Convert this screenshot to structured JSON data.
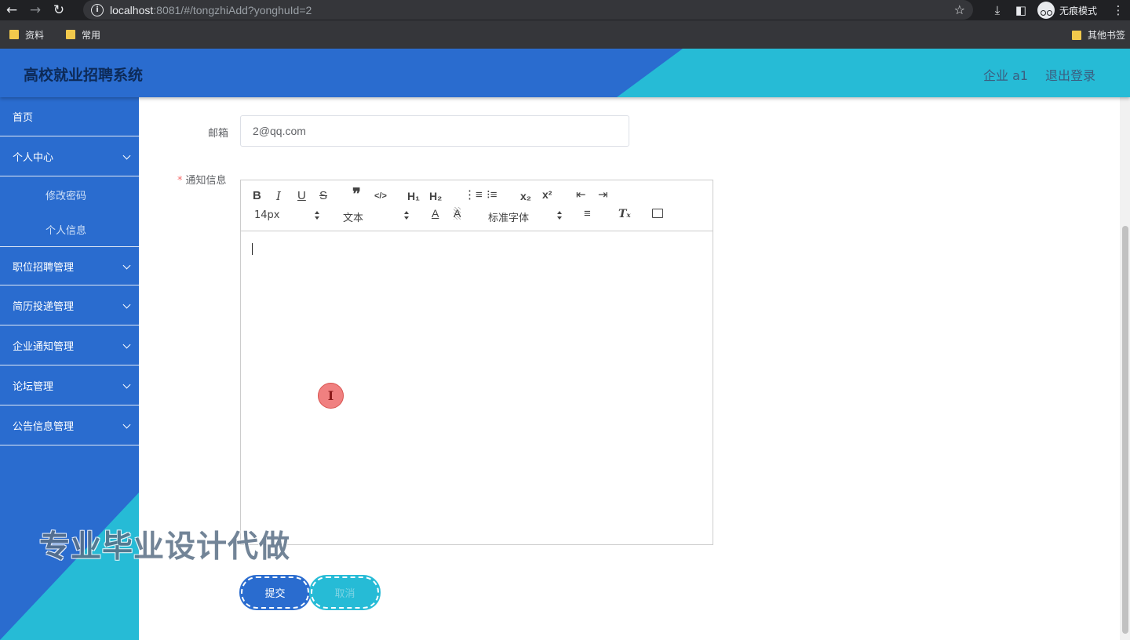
{
  "browser": {
    "url_host": "localhost",
    "url_path": ":8081/#/tongzhiAdd?yonghuId=2",
    "incognito_label": "无痕模式",
    "bookmarks": [
      "资料",
      "常用"
    ],
    "other_bookmarks": "其他书签"
  },
  "header": {
    "title": "高校就业招聘系统",
    "user": "企业 a1",
    "logout": "退出登录"
  },
  "sidebar": {
    "items": [
      {
        "label": "首页"
      },
      {
        "label": "个人中心",
        "children": [
          "修改密码",
          "个人信息"
        ]
      },
      {
        "label": "职位招聘管理"
      },
      {
        "label": "简历投递管理"
      },
      {
        "label": "企业通知管理"
      },
      {
        "label": "论坛管理"
      },
      {
        "label": "公告信息管理"
      }
    ]
  },
  "form": {
    "email_label": "邮箱",
    "email_value": "2@qq.com",
    "notice_label": "通知信息",
    "required_mark": "*",
    "submit": "提交",
    "cancel": "取消"
  },
  "editor": {
    "font_size": "14px",
    "header_select": "文本",
    "font_family": "标准字体",
    "toolbar_icons": [
      "bold-icon",
      "italic-icon",
      "underline-icon",
      "strike-icon",
      "blockquote-icon",
      "code-block-icon",
      "h1-icon",
      "h2-icon",
      "ordered-list-icon",
      "bullet-list-icon",
      "subscript-icon",
      "superscript-icon",
      "outdent-icon",
      "indent-icon",
      "font-color-icon",
      "background-color-icon",
      "align-icon",
      "clean-format-icon",
      "image-icon"
    ]
  },
  "watermark": "专业毕业设计代做",
  "colors": {
    "primary": "#2a6ccf",
    "accent": "#26bbd6",
    "browser_dark": "#202124"
  }
}
